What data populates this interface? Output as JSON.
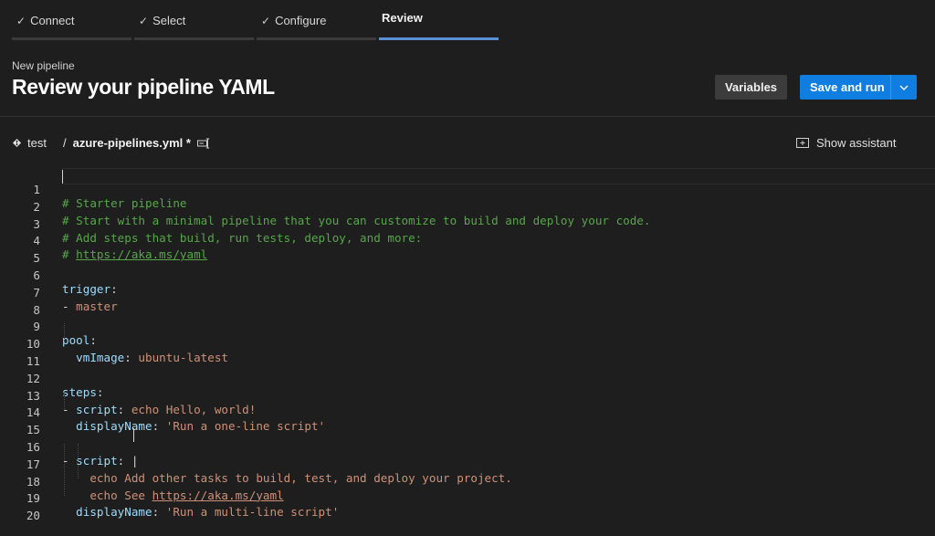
{
  "wizard": {
    "steps": [
      {
        "label": "Connect",
        "done": true
      },
      {
        "label": "Select",
        "done": true
      },
      {
        "label": "Configure",
        "done": true
      },
      {
        "label": "Review",
        "done": false,
        "active": true
      }
    ],
    "check_glyph": "✓"
  },
  "header": {
    "subtitle": "New pipeline",
    "title": "Review your pipeline YAML",
    "variables_label": "Variables",
    "save_run_label": "Save and run"
  },
  "file_bar": {
    "branch_icon": "git-branch-icon",
    "branch": "test",
    "separator": "/",
    "file_name": "azure-pipelines.yml *",
    "rename_icon": "rename-icon",
    "assistant_icon": "panel-icon",
    "assistant_label": "Show assistant"
  },
  "editor": {
    "line_numbers": [
      "1",
      "2",
      "3",
      "4",
      "5",
      "6",
      "7",
      "8",
      "9",
      "10",
      "11",
      "12",
      "13",
      "14",
      "15",
      "16",
      "17",
      "18",
      "19",
      "20"
    ],
    "lines": {
      "l1": "# Starter pipeline",
      "l2": "# Start with a minimal pipeline that you can customize to build and deploy your code.",
      "l3": "# Add steps that build, run tests, deploy, and more:",
      "l4_hash": "# ",
      "l4_link": "https://aka.ms/yaml",
      "l6_key": "trigger",
      "l7_dash": "- ",
      "l7_val": "master",
      "l9_key": "pool",
      "l10_key": "vmImage",
      "l10_val": "ubuntu-latest",
      "l12_key": "steps",
      "l13_dash": "- ",
      "l13_key": "script",
      "l13_val": "echo Hello, world!",
      "l14_key": "displayName",
      "l14_val": "'Run a one-line script'",
      "l16_dash": "- ",
      "l16_key": "script",
      "l16_val": "|",
      "l17_val": "echo Add other tasks to build, test, and deploy your project.",
      "l18_val": "echo See ",
      "l18_link": "https://aka.ms/yaml",
      "l19_key": "displayName",
      "l19_val": "'Run a multi-line script'"
    }
  },
  "colors": {
    "background": "#1e1e1e",
    "accent": "#0f7ee0",
    "comment": "#57a64a",
    "key": "#9cdcfe",
    "value": "#ce9178",
    "active_tab": "#5b8fd6"
  }
}
